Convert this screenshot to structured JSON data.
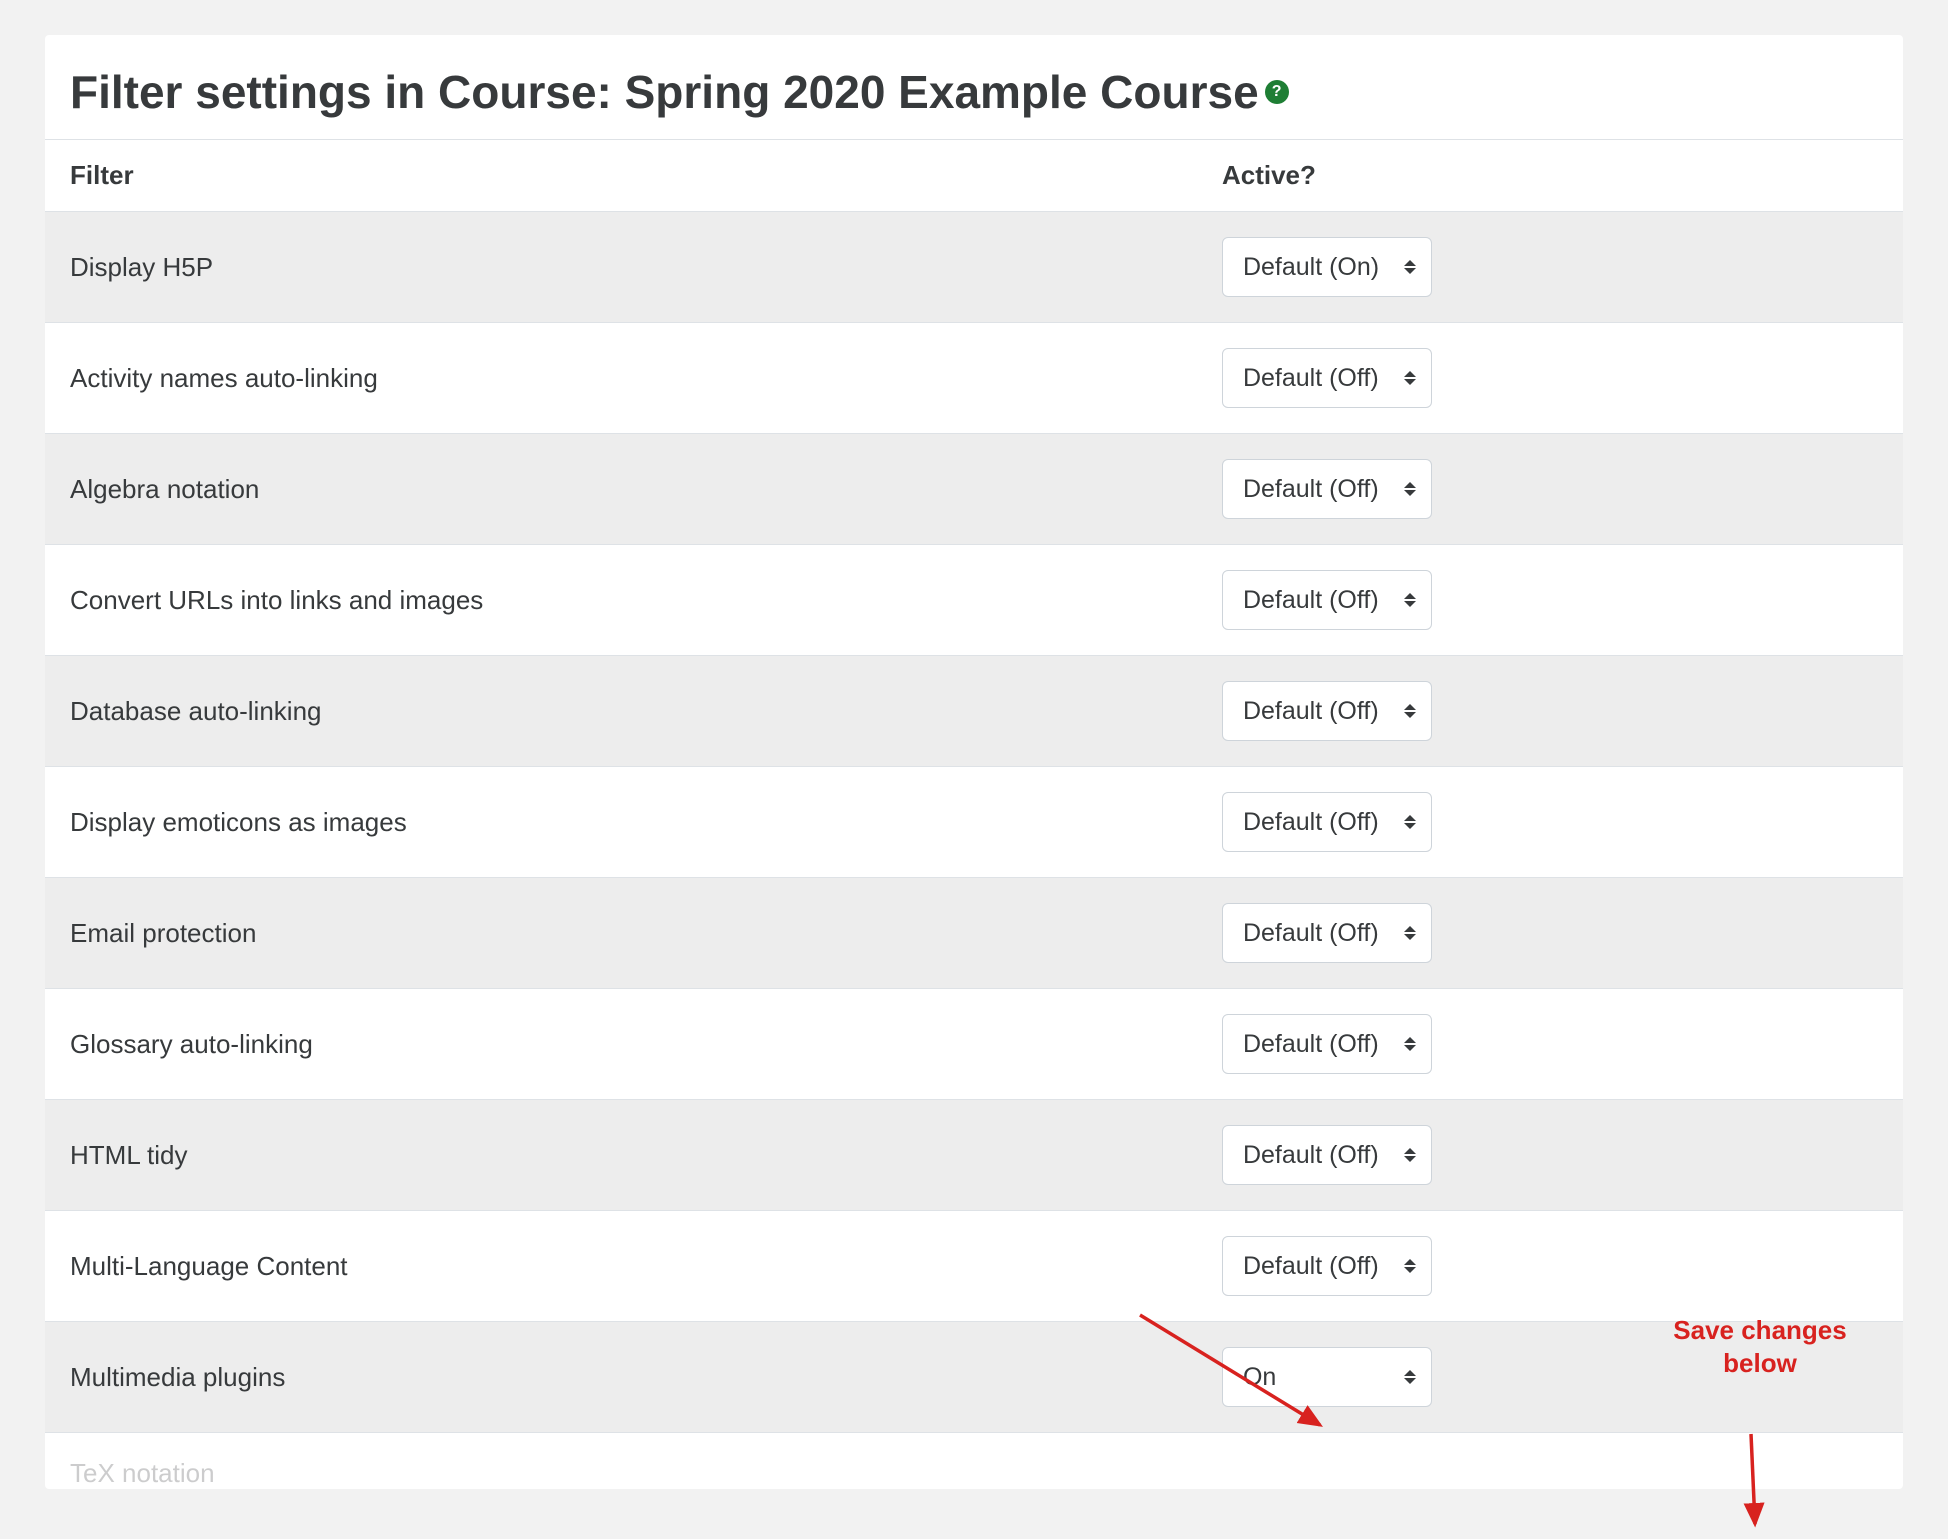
{
  "page": {
    "title": "Filter settings in Course: Spring 2020 Example Course",
    "help_icon": "question-circle-icon"
  },
  "table": {
    "headers": {
      "filter": "Filter",
      "active": "Active?"
    },
    "rows": [
      {
        "label": "Display H5P",
        "value": "Default (On)"
      },
      {
        "label": "Activity names auto-linking",
        "value": "Default (Off)"
      },
      {
        "label": "Algebra notation",
        "value": "Default (Off)"
      },
      {
        "label": "Convert URLs into links and images",
        "value": "Default (Off)"
      },
      {
        "label": "Database auto-linking",
        "value": "Default (Off)"
      },
      {
        "label": "Display emoticons as images",
        "value": "Default (Off)"
      },
      {
        "label": "Email protection",
        "value": "Default (Off)"
      },
      {
        "label": "Glossary auto-linking",
        "value": "Default (Off)"
      },
      {
        "label": "HTML tidy",
        "value": "Default (Off)"
      },
      {
        "label": "Multi-Language Content",
        "value": "Default (Off)"
      },
      {
        "label": "Multimedia plugins",
        "value": "On"
      },
      {
        "label": "TeX notation",
        "value": ""
      }
    ]
  },
  "annotations": {
    "save_changes_label": "Save changes\nbelow",
    "arrow_color": "#d8221f"
  }
}
